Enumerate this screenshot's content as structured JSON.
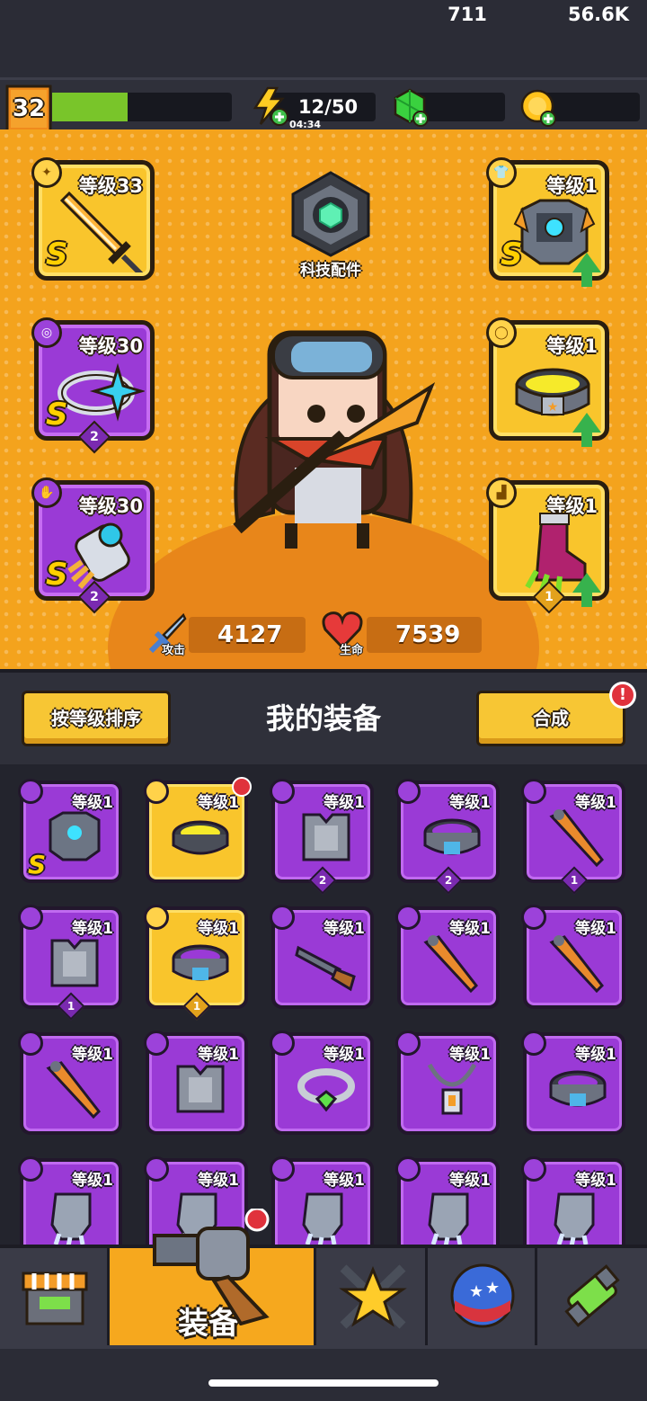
{
  "player": {
    "level": "32",
    "xp_fraction": 0.42
  },
  "resources": {
    "energy": {
      "value": "12/50",
      "timer": "04:34"
    },
    "gems": {
      "value": "711"
    },
    "coins": {
      "value": "56.6K"
    }
  },
  "hero": {
    "tech_parts_label": "科技配件",
    "slots_left": [
      {
        "level": "等级33",
        "rank": "S",
        "color": "gold",
        "icon": "sword-icon"
      },
      {
        "level": "等级30",
        "rank": "S",
        "color": "purple",
        "icon": "ring-icon",
        "count": "2"
      },
      {
        "level": "等级30",
        "rank": "S",
        "color": "purple",
        "icon": "gauntlet-icon",
        "count": "2"
      }
    ],
    "slots_right": [
      {
        "level": "等级1",
        "rank": "S",
        "color": "gold",
        "icon": "armor-icon",
        "upgrade": true
      },
      {
        "level": "等级1",
        "color": "gold",
        "icon": "belt-icon",
        "upgrade": true
      },
      {
        "level": "等级1",
        "color": "gold",
        "icon": "boots-icon",
        "upgrade": true,
        "count": "1"
      }
    ],
    "attack": {
      "label": "攻击",
      "value": "4127"
    },
    "health": {
      "label": "生命",
      "value": "7539"
    }
  },
  "section": {
    "sort_button": "按等级排序",
    "title": "我的装备",
    "merge_button": "合成"
  },
  "inventory": [
    {
      "level": "等级1",
      "color": "purple",
      "icon": "armor-icon",
      "rank": "S"
    },
    {
      "level": "等级1",
      "color": "gold",
      "icon": "spiked-belt-icon",
      "alert": true
    },
    {
      "level": "等级1",
      "color": "purple",
      "icon": "vest-icon",
      "count": "2"
    },
    {
      "level": "等级1",
      "color": "purple",
      "icon": "belt-icon",
      "count": "2"
    },
    {
      "level": "等级1",
      "color": "purple",
      "icon": "bat-icon",
      "count": "1"
    },
    {
      "level": "等级1",
      "color": "purple",
      "icon": "vest-icon",
      "count": "1"
    },
    {
      "level": "等级1",
      "color": "gold",
      "icon": "belt-icon",
      "count": "1"
    },
    {
      "level": "等级1",
      "color": "purple",
      "icon": "shotgun-icon"
    },
    {
      "level": "等级1",
      "color": "purple",
      "icon": "bat-icon"
    },
    {
      "level": "等级1",
      "color": "purple",
      "icon": "bat-icon"
    },
    {
      "level": "等级1",
      "color": "purple",
      "icon": "bat-icon"
    },
    {
      "level": "等级1",
      "color": "purple",
      "icon": "vest-icon"
    },
    {
      "level": "等级1",
      "color": "purple",
      "icon": "ring-icon"
    },
    {
      "level": "等级1",
      "color": "purple",
      "icon": "necklace-icon"
    },
    {
      "level": "等级1",
      "color": "purple",
      "icon": "belt-icon"
    },
    {
      "level": "等级1",
      "color": "purple",
      "icon": "glove-icon"
    },
    {
      "level": "等级1",
      "color": "purple",
      "icon": "glove-icon"
    },
    {
      "level": "等级1",
      "color": "purple",
      "icon": "glove-icon"
    },
    {
      "level": "等级1",
      "color": "purple",
      "icon": "glove-icon"
    },
    {
      "level": "等级1",
      "color": "purple",
      "icon": "glove-icon"
    }
  ],
  "nav": {
    "tabs": [
      {
        "icon": "shop-icon"
      },
      {
        "icon": "revolver-icon",
        "label": "装备",
        "active": true
      },
      {
        "icon": "crossed-swords-star-icon"
      },
      {
        "icon": "star-ball-icon"
      },
      {
        "icon": "dna-capsule-icon"
      }
    ]
  },
  "colors": {
    "orange": "#f4a31d",
    "gold": "#f9c52c",
    "purple": "#9a3ad6",
    "dark": "#2b2c36",
    "green": "#79c52a"
  }
}
